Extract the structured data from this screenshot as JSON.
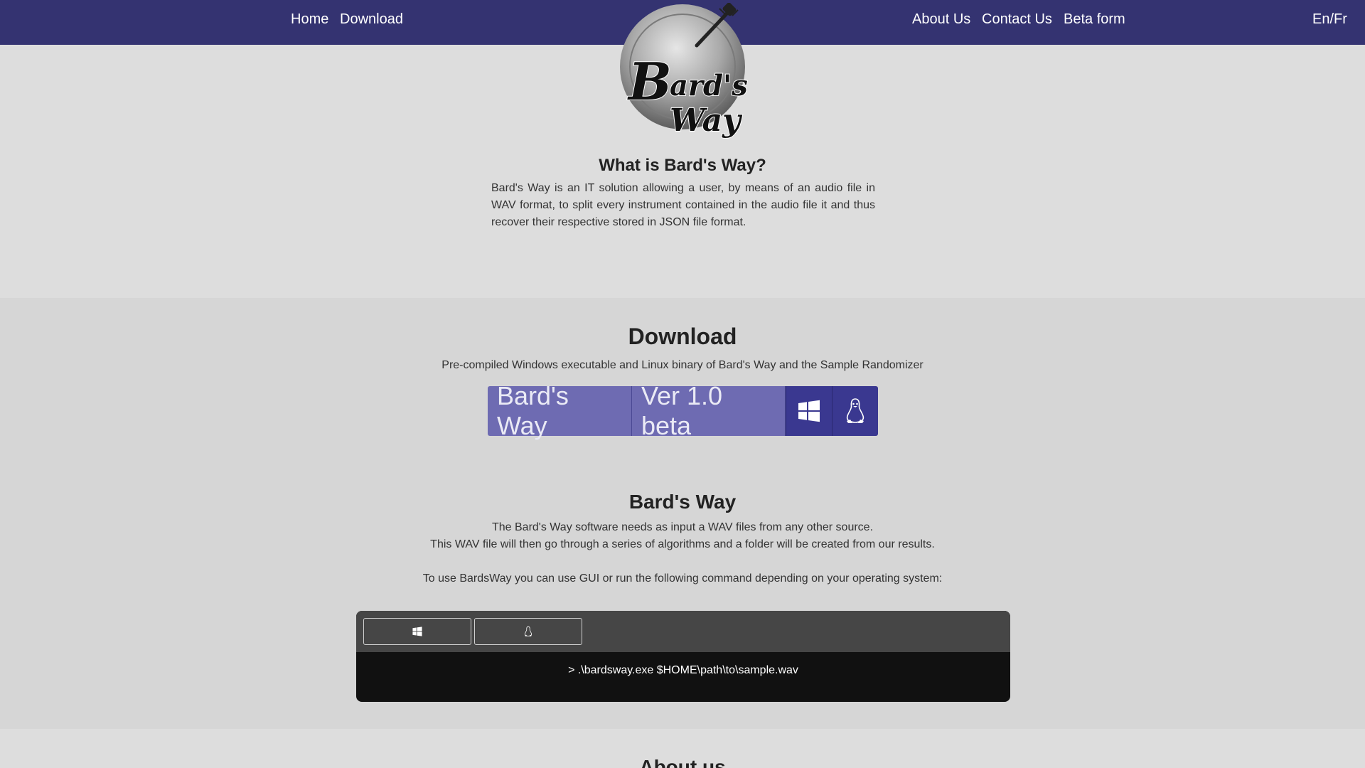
{
  "nav": {
    "left": [
      "Home",
      "Download"
    ],
    "right": [
      "About Us",
      "Contact Us",
      "Beta form"
    ],
    "lang": "En/Fr"
  },
  "logo": {
    "line1": "Bard's",
    "line2": "Way"
  },
  "intro": {
    "title": "What is Bard's Way?",
    "text": "Bard's Way is an IT solution allowing a user, by means of an audio file in WAV format, to split every instrument contained in the audio file it and thus recover their respective stored in JSON file format."
  },
  "download": {
    "title": "Download",
    "subtitle": "Pre-compiled Windows executable and Linux binary of Bard's Way and the Sample Randomizer",
    "product_label": "Bard's Way",
    "version_label": "Ver 1.0 beta",
    "os_buttons": [
      "windows-icon",
      "linux-icon"
    ]
  },
  "bardsway": {
    "title": "Bard's Way",
    "line1": "The Bard's Way software needs as input a WAV files from any other source.",
    "line2": "This WAV file will then go through a series of algorithms and a folder will be created from our results.",
    "line3": "To use BardsWay you can use GUI or run the following command depending on your operating system:",
    "command": "> .\\bardsway.exe $HOME\\path\\to\\sample.wav"
  },
  "about": {
    "title": "About us"
  },
  "colors": {
    "navbar": "#343371",
    "label_bg": "#6e6bb2",
    "os_btn_bg": "#3a3890",
    "terminal_header": "#464646",
    "terminal_body": "#111111"
  }
}
